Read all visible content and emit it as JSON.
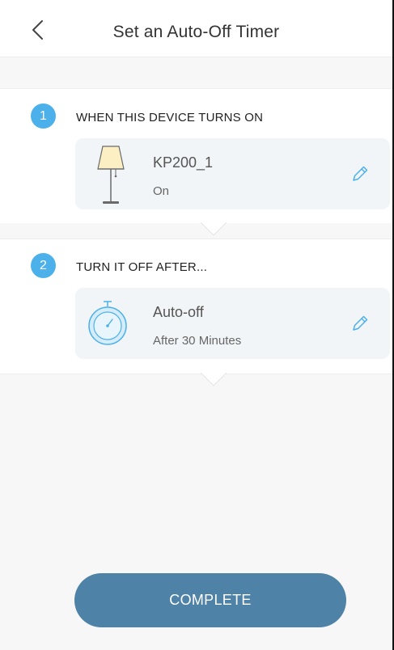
{
  "header": {
    "title": "Set an Auto-Off Timer"
  },
  "step1": {
    "number": "1",
    "label": "WHEN THIS DEVICE TURNS ON",
    "card": {
      "icon": "floor-lamp-icon",
      "title": "KP200_1",
      "subtitle": "On"
    }
  },
  "step2": {
    "number": "2",
    "label": "TURN IT OFF AFTER...",
    "card": {
      "icon": "stopwatch-icon",
      "title": "Auto-off",
      "subtitle": "After 30 Minutes"
    }
  },
  "footer": {
    "complete_label": "COMPLETE"
  },
  "colors": {
    "accent": "#4cb1ea",
    "button": "#4e82a6",
    "card_bg": "#f1f5f8",
    "page_bg": "#f7f7f7"
  }
}
